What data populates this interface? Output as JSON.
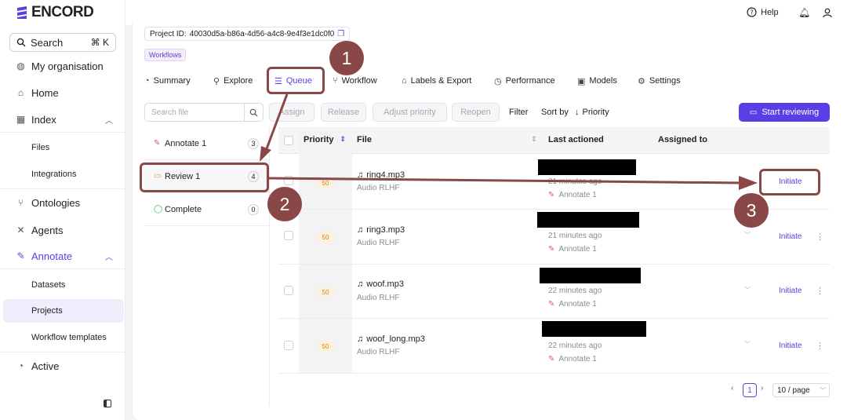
{
  "app": {
    "logo_text": "ENCORD"
  },
  "sidebar": {
    "search_label": "Search",
    "search_shortcut": "⌘ K",
    "items": [
      {
        "label": "My organisation"
      },
      {
        "label": "Home"
      },
      {
        "label": "Index"
      },
      {
        "label": "Files"
      },
      {
        "label": "Integrations"
      },
      {
        "label": "Ontologies"
      },
      {
        "label": "Agents"
      },
      {
        "label": "Annotate"
      },
      {
        "label": "Datasets"
      },
      {
        "label": "Projects"
      },
      {
        "label": "Workflow templates"
      },
      {
        "label": "Active"
      }
    ]
  },
  "topbar": {
    "help_label": "Help"
  },
  "project": {
    "id_label": "Project ID:",
    "id_value": "40030d5a-b86a-4d56-a4c8-9e4f3e1dc0f0",
    "badge": "Workflows"
  },
  "tabs": [
    {
      "label": "Summary"
    },
    {
      "label": "Explore"
    },
    {
      "label": "Queue"
    },
    {
      "label": "Workflow"
    },
    {
      "label": "Labels & Export"
    },
    {
      "label": "Performance"
    },
    {
      "label": "Models"
    },
    {
      "label": "Settings"
    }
  ],
  "toolbar": {
    "search_placeholder": "Search file",
    "assign": "Assign",
    "release": "Release",
    "adjust_priority": "Adjust priority",
    "reopen": "Reopen",
    "filter": "Filter",
    "sort_by": "Sort by",
    "sort_field": "Priority",
    "start_reviewing": "Start reviewing"
  },
  "stages": [
    {
      "label": "Annotate 1",
      "count": "3"
    },
    {
      "label": "Review 1",
      "count": "4"
    },
    {
      "label": "Complete",
      "count": "0"
    }
  ],
  "table": {
    "headers": {
      "priority": "Priority",
      "file": "File",
      "last_actioned": "Last actioned",
      "assigned_to": "Assigned to"
    },
    "rows": [
      {
        "priority": "50",
        "file": "ring4.mp3",
        "type": "Audio RLHF",
        "ago": "21 minutes ago",
        "stage": "Annotate 1",
        "action": "Initiate"
      },
      {
        "priority": "50",
        "file": "ring3.mp3",
        "type": "Audio RLHF",
        "ago": "21 minutes ago",
        "stage": "Annotate 1",
        "action": "Initiate"
      },
      {
        "priority": "50",
        "file": "woof.mp3",
        "type": "Audio RLHF",
        "ago": "22 minutes ago",
        "stage": "Annotate 1",
        "action": "Initiate"
      },
      {
        "priority": "50",
        "file": "woof_long.mp3",
        "type": "Audio RLHF",
        "ago": "22 minutes ago",
        "stage": "Annotate 1",
        "action": "Initiate"
      }
    ]
  },
  "pagination": {
    "page": "1",
    "per_page": "10 / page"
  },
  "markers": [
    "1",
    "2",
    "3"
  ],
  "colors": {
    "accent": "#5b3fe6",
    "annotation": "#8a4747",
    "priority_bg": "#fdf1dc"
  }
}
